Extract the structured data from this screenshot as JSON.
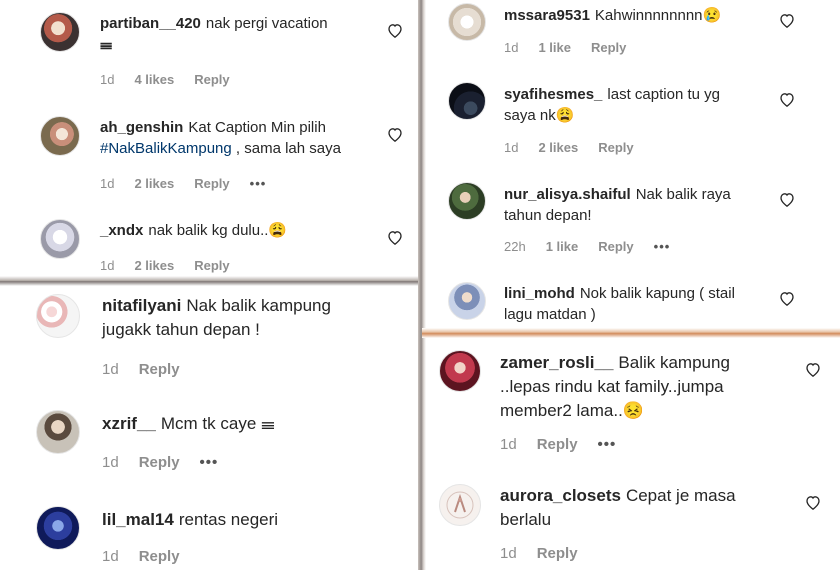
{
  "colors": {
    "text": "#262626",
    "meta": "#8e8e8e",
    "hashtag": "#00376b"
  },
  "comments": [
    {
      "username": "partiban__420",
      "text_lines": [
        "nak pergi vacation",
        "𝍢"
      ],
      "time": "1d",
      "likes": "4 likes",
      "reply": "Reply",
      "avatar": "avatar-photo"
    },
    {
      "username": "ah_genshin",
      "text_pre": "Kat Caption Min pilih",
      "hashtag": "#NakBalikKampung",
      "text_post": ", sama lah saya",
      "time": "1d",
      "likes": "2 likes",
      "reply": "Reply",
      "more": "•••",
      "avatar": "avatar-photo"
    },
    {
      "username": "_xndx",
      "text": "nak balik kg dulu..😩",
      "time": "1d",
      "likes": "2 likes",
      "reply": "Reply",
      "avatar": "avatar-photo"
    },
    {
      "username": "nitafilyani",
      "text_lines": [
        "Nak balik kampung",
        "jugakk tahun depan !"
      ],
      "time": "1d",
      "reply": "Reply",
      "avatar": "avatar-photo"
    },
    {
      "username": "xzrif__",
      "text": "Mcm tk caye 𝍢",
      "time": "1d",
      "reply": "Reply",
      "more": "•••",
      "avatar": "avatar-photo"
    },
    {
      "username": "lil_mal14",
      "text": "rentas negeri",
      "time": "1d",
      "reply": "Reply",
      "avatar": "avatar-photo"
    },
    {
      "username": "mssara9531",
      "text": "Kahwinnnnnnnn😢",
      "time": "1d",
      "likes": "1 like",
      "reply": "Reply",
      "avatar": "avatar-photo"
    },
    {
      "username": "syafihesmes_",
      "text_lines": [
        "last caption tu yg",
        "saya nk😩"
      ],
      "time": "1d",
      "likes": "2 likes",
      "reply": "Reply",
      "avatar": "avatar-photo"
    },
    {
      "username": "nur_alisya.shaiful",
      "text_lines": [
        "Nak balik raya",
        "tahun depan!"
      ],
      "time": "22h",
      "likes": "1 like",
      "reply": "Reply",
      "more": "•••",
      "avatar": "avatar-photo"
    },
    {
      "username": "lini_mohd",
      "text_lines": [
        "Nok balik kapung ( stail",
        "lagu matdan )"
      ],
      "avatar": "avatar-photo"
    },
    {
      "username": "zamer_rosli__",
      "text_lines": [
        "Balik kampung",
        "..lepas rindu kat family..jumpa",
        "member2 lama..😣"
      ],
      "time": "1d",
      "reply": "Reply",
      "more": "•••",
      "avatar": "avatar-photo"
    },
    {
      "username": "aurora_closets",
      "text_lines": [
        "Cepat je masa",
        "berlalu"
      ],
      "time": "1d",
      "reply": "Reply",
      "avatar": "avatar-logo"
    }
  ]
}
